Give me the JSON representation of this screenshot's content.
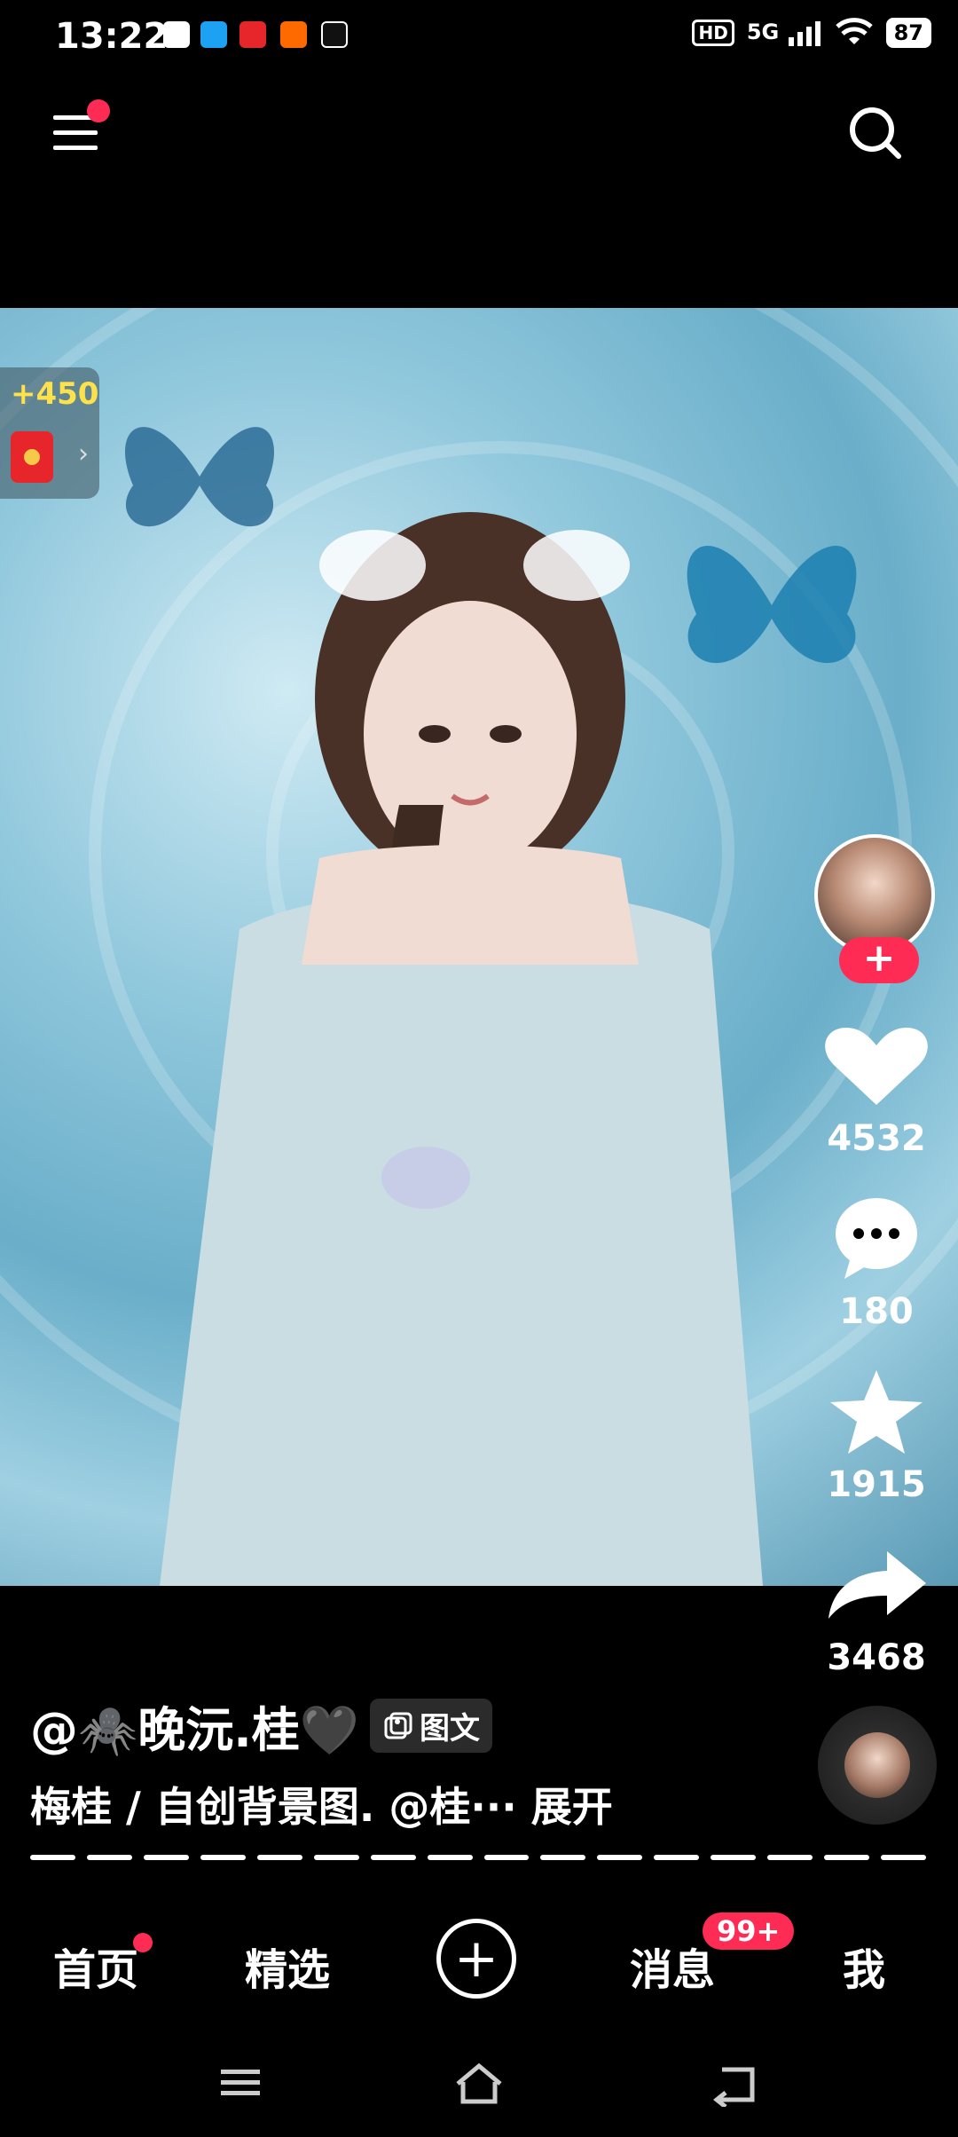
{
  "status_bar": {
    "time": "13:22",
    "network": "5G",
    "battery": "87",
    "hd": "HD"
  },
  "reward": {
    "amount": "+450"
  },
  "actions": {
    "likes": "4532",
    "comments": "180",
    "favorites": "1915",
    "shares": "3468"
  },
  "caption": {
    "author": "@🕷️晚沅.桂🖤",
    "tag_label": "图文",
    "description": "梅桂 / 自创背景图. @桂··· 展开"
  },
  "bottom_nav": {
    "home": "首页",
    "featured": "精选",
    "messages": "消息",
    "me": "我",
    "messages_badge": "99+"
  },
  "colors": {
    "accent": "#fe2c55",
    "background": "#000000"
  },
  "icons": [
    "menu-icon",
    "search-icon",
    "heart-icon",
    "comment-icon",
    "star-icon",
    "share-icon",
    "plus-icon",
    "system-menu-icon",
    "system-home-icon",
    "system-back-icon"
  ]
}
